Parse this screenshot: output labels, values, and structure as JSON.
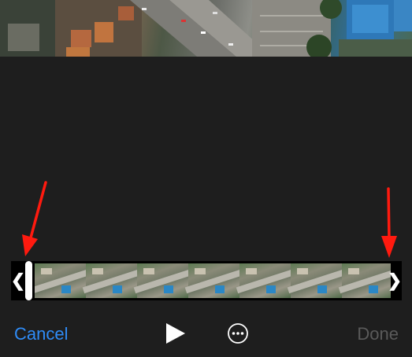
{
  "toolbar": {
    "cancel_label": "Cancel",
    "done_label": "Done",
    "play_icon": "play-icon",
    "more_icon": "ellipsis-circle-icon"
  },
  "trim": {
    "left_handle_glyph": "❮",
    "right_handle_glyph": "❯",
    "frame_count": 7
  },
  "annotations": {
    "arrow_color": "#ff1a0f"
  },
  "colors": {
    "accent": "#2f8cf7",
    "disabled": "#5a5a5a",
    "background": "#1e1e1e"
  }
}
